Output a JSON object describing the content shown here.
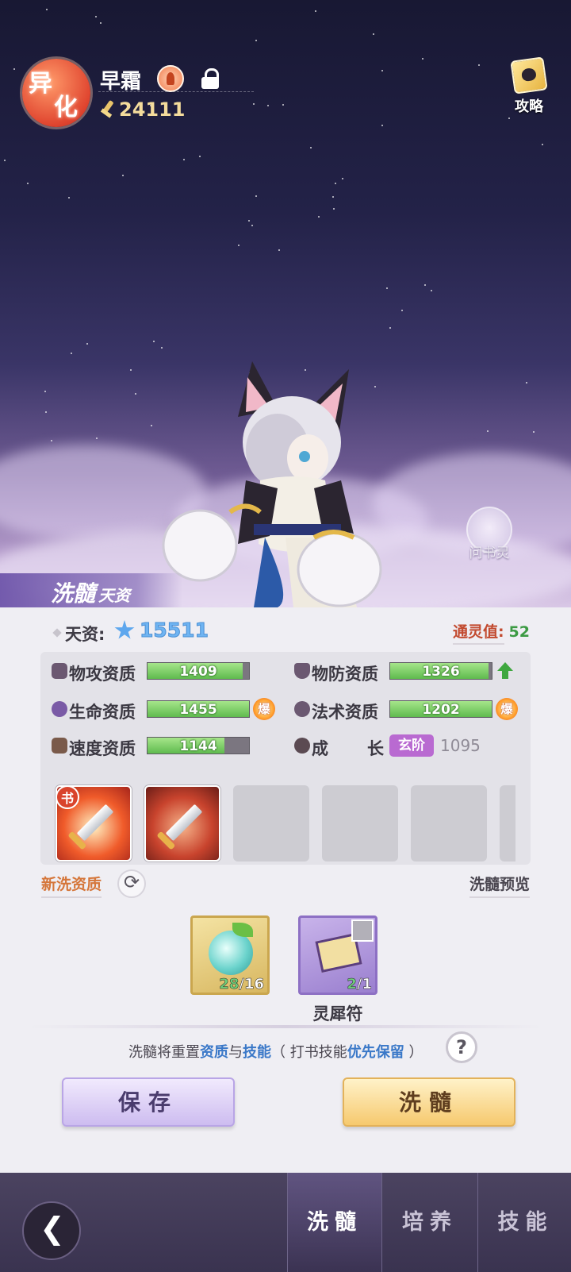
{
  "header": {
    "badge": [
      "异",
      "化"
    ],
    "pet_name": "早霜",
    "power": "24111",
    "guide_label": "攻略"
  },
  "hero": {
    "assistant_label": "问书灵",
    "section_title": "洗髓",
    "section_subtitle": "天资"
  },
  "talent": {
    "label": "天资:",
    "value": "15511"
  },
  "affinity": {
    "label": "通灵值:",
    "value": "52"
  },
  "stats": [
    {
      "label": "物攻资质",
      "value": "1409",
      "fill": 0.94,
      "icon": "claw-icon"
    },
    {
      "label": "物防资质",
      "value": "1326",
      "fill": 0.97,
      "icon": "shield-icon",
      "indicator": "up-arrow"
    },
    {
      "label": "生命资质",
      "value": "1455",
      "fill": 1.0,
      "icon": "heart-icon",
      "indicator": "爆"
    },
    {
      "label": "法术资质",
      "value": "1202",
      "fill": 1.0,
      "icon": "magic-swirl-icon",
      "indicator": "爆"
    },
    {
      "label": "速度资质",
      "value": "1144",
      "fill": 0.76,
      "icon": "boot-icon"
    }
  ],
  "growth": {
    "label_a": "成",
    "label_b": "长",
    "tier": "玄阶",
    "value": "1095"
  },
  "skills": {
    "book_tag": "书",
    "filled": [
      "sword-skill-1",
      "sword-skill-2"
    ],
    "empty_slots": 4
  },
  "links": {
    "new_quality": "新洗资质",
    "preview": "洗髓预览"
  },
  "items": [
    {
      "name": "potion",
      "have": "28",
      "need": "16"
    },
    {
      "name": "灵犀符",
      "have": "2",
      "need": "1"
    }
  ],
  "notice": {
    "p1": "洗髓将重置",
    "p2": "资质",
    "p3": "与",
    "p4": "技能",
    "p5": "（ 打书技能",
    "p6": "优先保留",
    "p7": " ）",
    "help": "?"
  },
  "buttons": {
    "save": "保存",
    "wash": "洗髓"
  },
  "nav": {
    "tabs": [
      "洗髓",
      "培养",
      "技能"
    ],
    "active": 0
  },
  "colors": {
    "accent_green": "#5fbb4e",
    "link_orange": "#d5763a",
    "notice_blue": "#3a78c8",
    "affinity_label": "#c24a2f",
    "affinity_value": "#3c9a43"
  }
}
